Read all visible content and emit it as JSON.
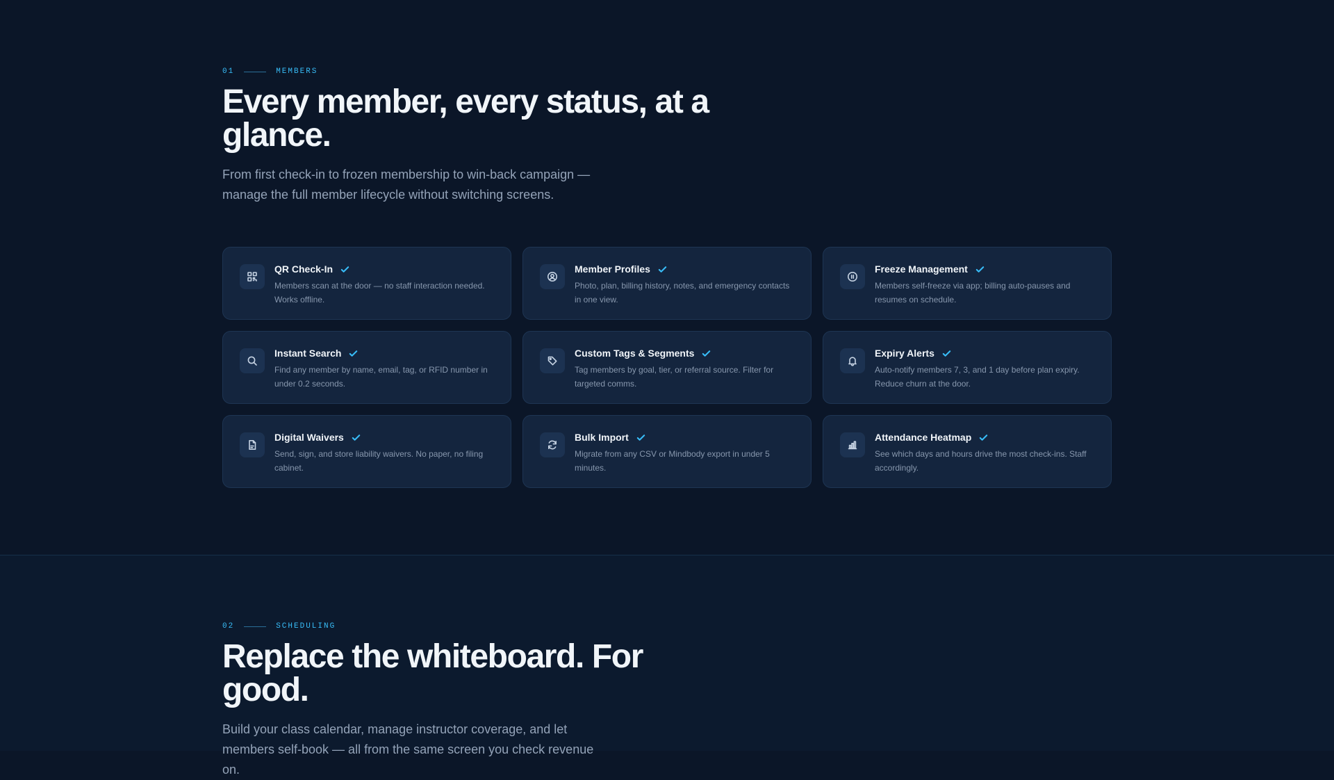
{
  "sections": [
    {
      "number": "01",
      "label": "MEMBERS",
      "headline": "Every member, every status, at a glance.",
      "lede": "From first check-in to frozen membership to win-back campaign — manage the full member lifecycle without switching screens.",
      "features": [
        {
          "title": "QR Check-In",
          "icon": "qr-code-icon",
          "desc": "Members scan at the door — no staff interaction needed. Works offline."
        },
        {
          "title": "Member Profiles",
          "icon": "user-circle-icon",
          "desc": "Photo, plan, billing history, notes, and emergency contacts in one view."
        },
        {
          "title": "Freeze Management",
          "icon": "pause-circle-icon",
          "desc": "Members self-freeze via app; billing auto-pauses and resumes on schedule."
        },
        {
          "title": "Instant Search",
          "icon": "search-icon",
          "desc": "Find any member by name, email, tag, or RFID number in under 0.2 seconds."
        },
        {
          "title": "Custom Tags & Segments",
          "icon": "tag-icon",
          "desc": "Tag members by goal, tier, or referral source. Filter for targeted comms."
        },
        {
          "title": "Expiry Alerts",
          "icon": "bell-icon",
          "desc": "Auto-notify members 7, 3, and 1 day before plan expiry. Reduce churn at the door."
        },
        {
          "title": "Digital Waivers",
          "icon": "document-icon",
          "desc": "Send, sign, and store liability waivers. No paper, no filing cabinet."
        },
        {
          "title": "Bulk Import",
          "icon": "refresh-icon",
          "desc": "Migrate from any CSV or Mindbody export in under 5 minutes."
        },
        {
          "title": "Attendance Heatmap",
          "icon": "bar-chart-icon",
          "desc": "See which days and hours drive the most check-ins. Staff accordingly."
        }
      ]
    },
    {
      "number": "02",
      "label": "SCHEDULING",
      "headline": "Replace the whiteboard. For good.",
      "lede": "Build your class calendar, manage instructor coverage, and let members self-book — all from the same screen you check revenue on."
    }
  ],
  "colors": {
    "background": "#0b1628",
    "card": "#14253e",
    "accent": "#38bdf8"
  }
}
